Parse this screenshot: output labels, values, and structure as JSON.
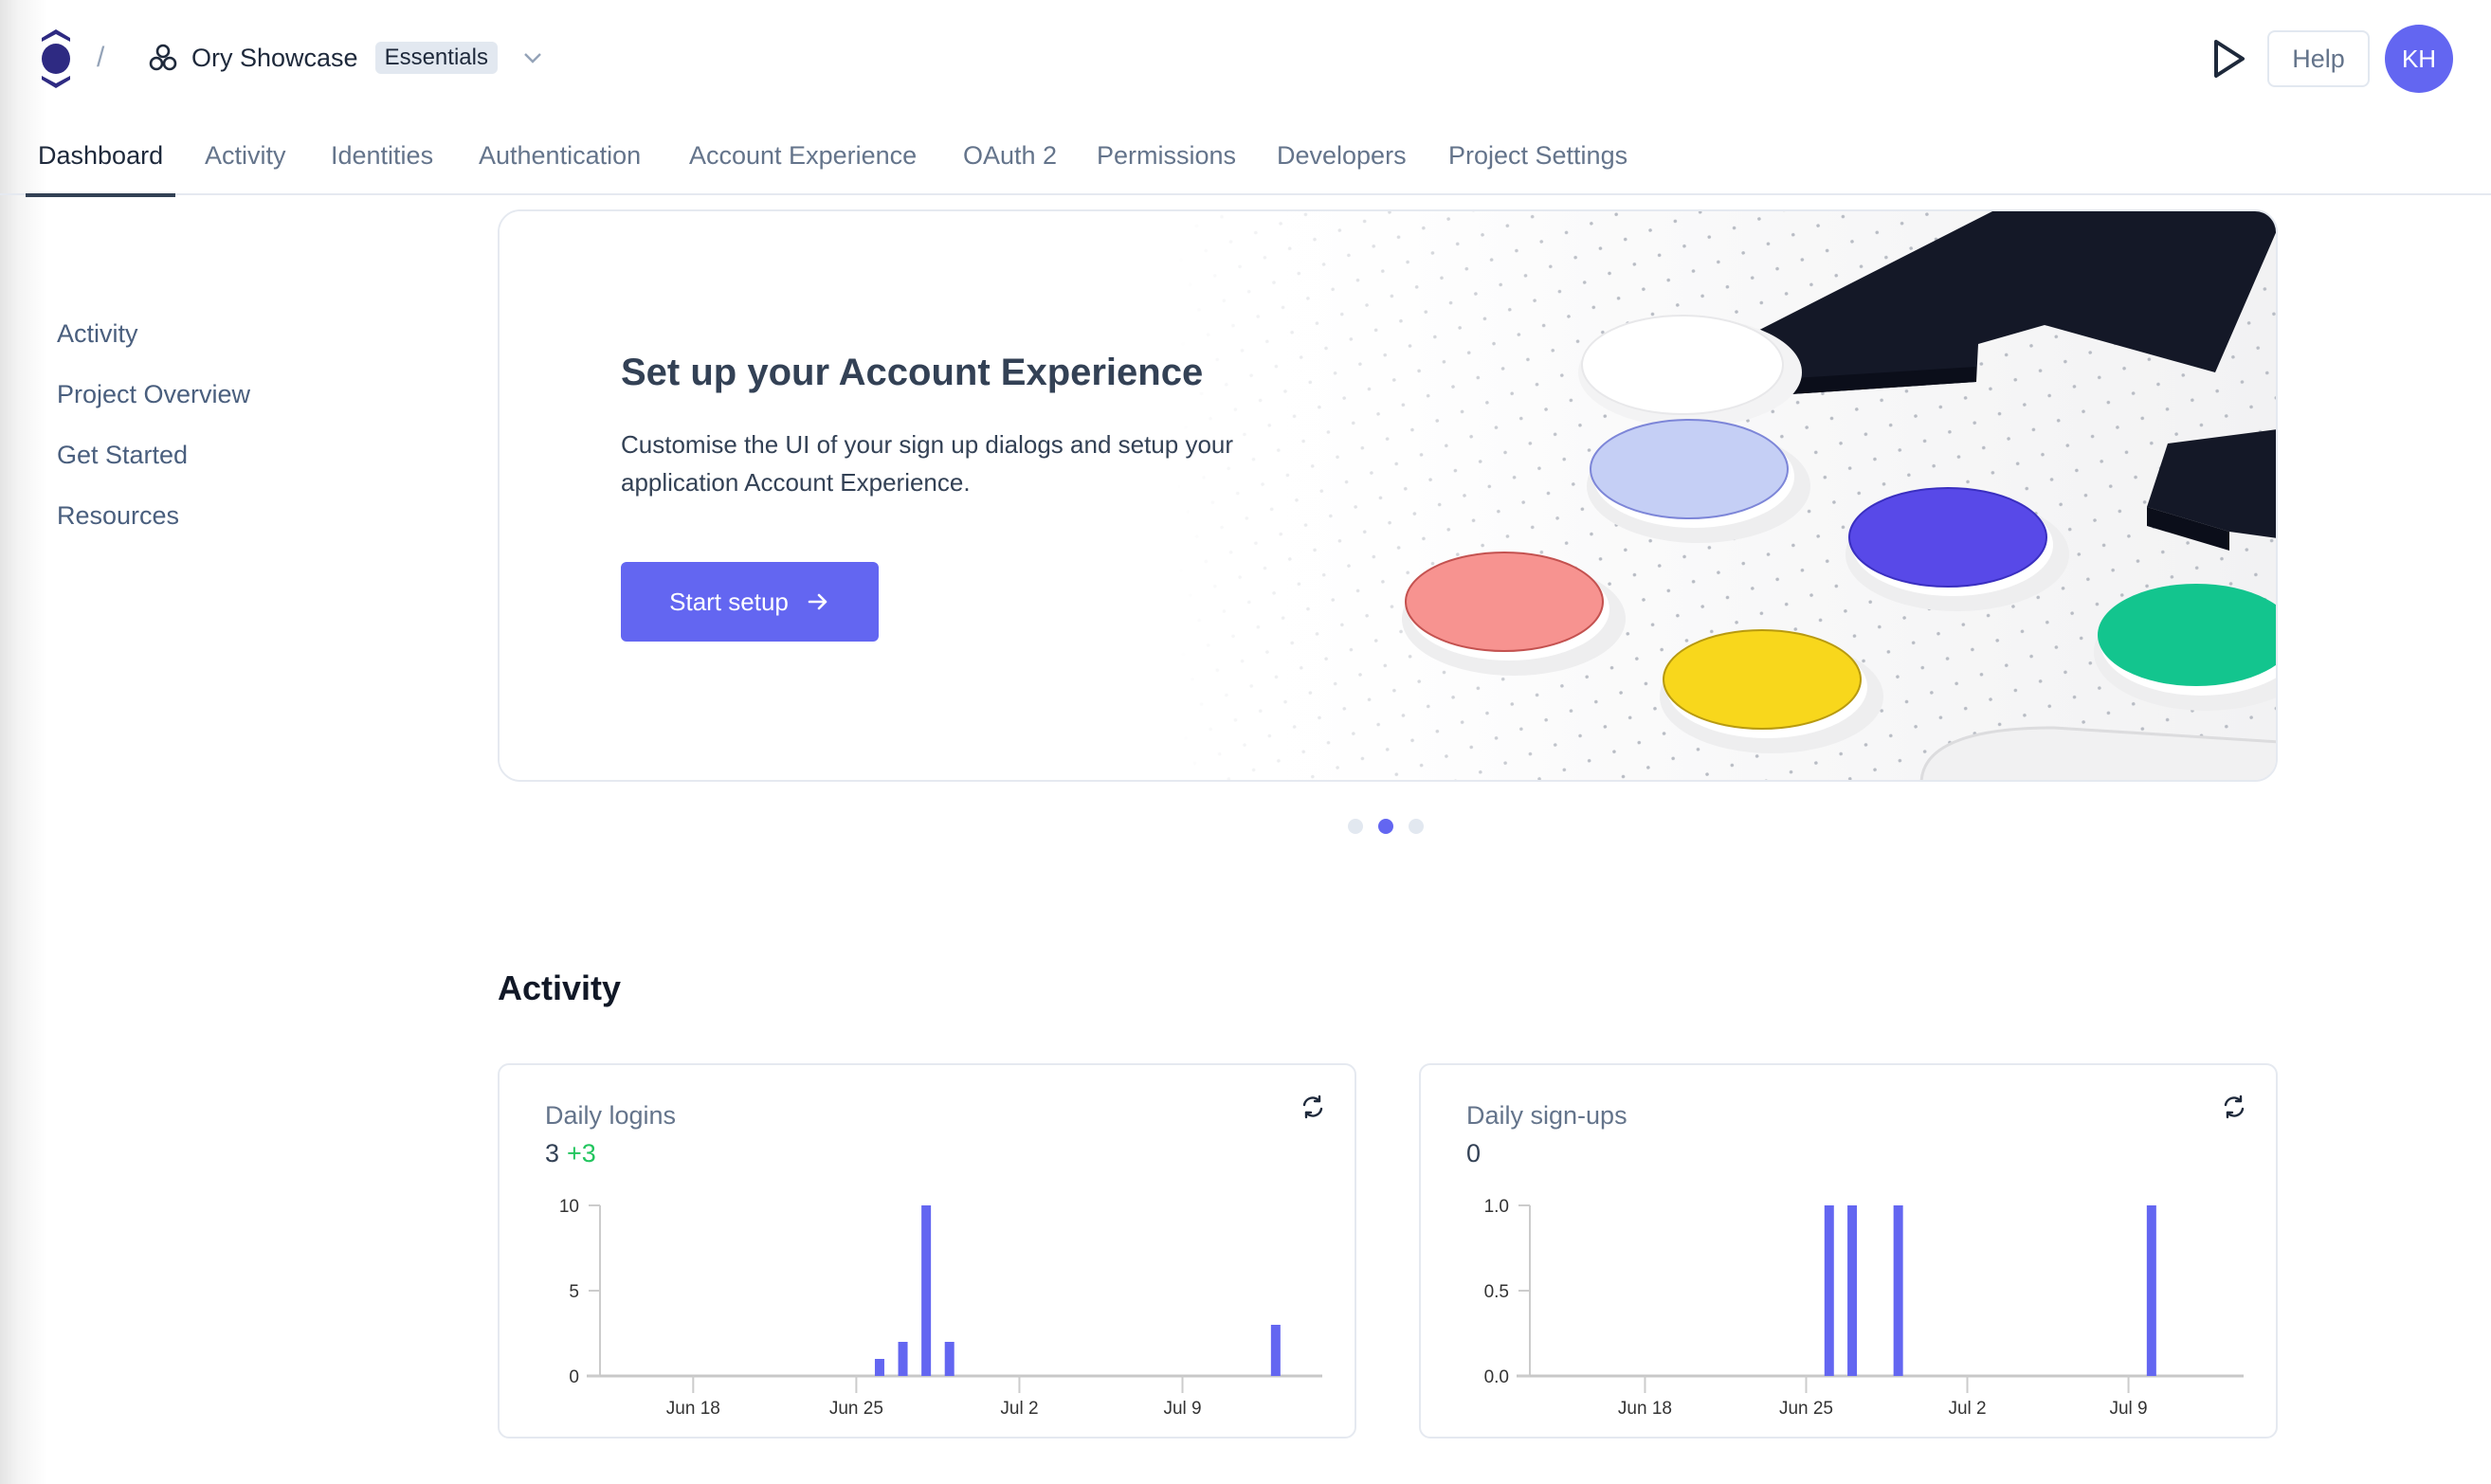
{
  "header": {
    "breadcrumb_separator": "/",
    "project_name": "Ory Showcase",
    "plan_badge": "Essentials",
    "help_label": "Help",
    "avatar_initials": "KH",
    "accent_color": "#6366f1",
    "logo_color": "#2e2a82"
  },
  "tabs": [
    {
      "label": "Dashboard",
      "active": true
    },
    {
      "label": "Activity",
      "active": false
    },
    {
      "label": "Identities",
      "active": false
    },
    {
      "label": "Authentication",
      "active": false
    },
    {
      "label": "Account Experience",
      "active": false
    },
    {
      "label": "OAuth 2",
      "active": false
    },
    {
      "label": "Permissions",
      "active": false
    },
    {
      "label": "Developers",
      "active": false
    },
    {
      "label": "Project Settings",
      "active": false
    }
  ],
  "sidebar": {
    "items": [
      {
        "label": "Activity"
      },
      {
        "label": "Project Overview"
      },
      {
        "label": "Get Started"
      },
      {
        "label": "Resources"
      }
    ]
  },
  "hero": {
    "title": "Set up your Account Experience",
    "description": "Customise the UI of your sign up dialogs and setup your application Account Experience.",
    "button_label": "Start setup",
    "button_icon": "arrow-right-icon",
    "carousel": {
      "total": 3,
      "active_index": 1
    }
  },
  "activity": {
    "title": "Activity",
    "cards": [
      {
        "title": "Daily logins",
        "value": "3",
        "delta": "+3",
        "refresh_icon": "refresh-icon"
      },
      {
        "title": "Daily sign-ups",
        "value": "0",
        "delta": "",
        "refresh_icon": "refresh-icon"
      }
    ]
  },
  "chart_data": [
    {
      "type": "bar",
      "title": "Daily logins",
      "xlabel": "",
      "ylabel": "",
      "x_ticks": [
        "Jun 18",
        "Jun 25",
        "Jul 2",
        "Jul 9"
      ],
      "x_range": [
        "Jun 14",
        "Jul 15"
      ],
      "y_ticks": [
        "0",
        "5",
        "10"
      ],
      "ylim": [
        0,
        10
      ],
      "grid": false,
      "color": "#6366f1",
      "points": [
        {
          "date": "Jun 26",
          "value": 1
        },
        {
          "date": "Jun 27",
          "value": 2
        },
        {
          "date": "Jun 28",
          "value": 10
        },
        {
          "date": "Jun 29",
          "value": 2
        },
        {
          "date": "Jul 13",
          "value": 3
        }
      ]
    },
    {
      "type": "bar",
      "title": "Daily sign-ups",
      "xlabel": "",
      "ylabel": "",
      "x_ticks": [
        "Jun 18",
        "Jun 25",
        "Jul 2",
        "Jul 9"
      ],
      "x_range": [
        "Jun 13",
        "Jul 14"
      ],
      "y_ticks": [
        "0.0",
        "0.5",
        "1.0"
      ],
      "ylim": [
        0,
        1
      ],
      "grid": false,
      "color": "#6366f1",
      "points": [
        {
          "date": "Jun 26",
          "value": 1
        },
        {
          "date": "Jun 27",
          "value": 1
        },
        {
          "date": "Jun 29",
          "value": 1
        },
        {
          "date": "Jul 10",
          "value": 1
        }
      ]
    }
  ]
}
